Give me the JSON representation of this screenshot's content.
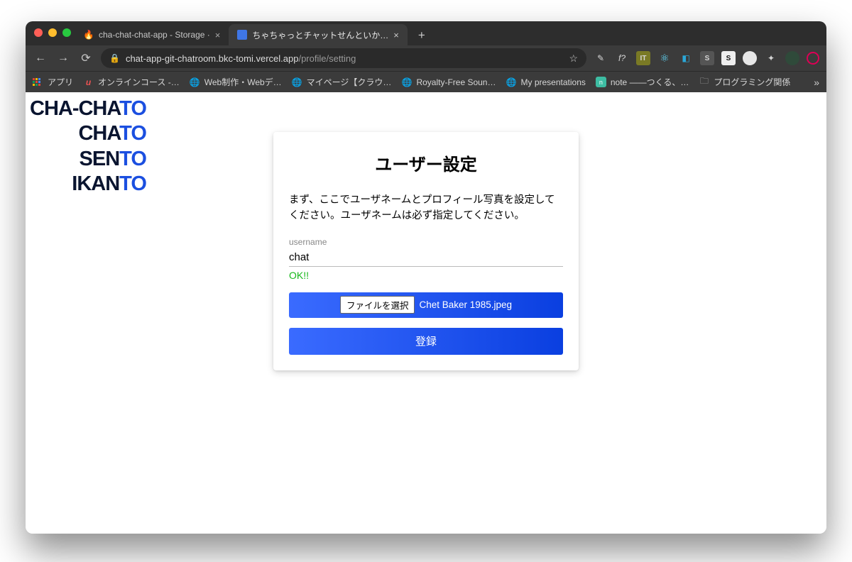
{
  "browser": {
    "tabs": [
      {
        "title": "cha-chat-chat-app - Storage ·",
        "active": false
      },
      {
        "title": "ちゃちゃっとチャットせんといか…",
        "active": true
      }
    ],
    "url_host": "chat-app-git-chatroom.bkc-tomi.vercel.app",
    "url_path": "/profile/setting",
    "bookmarks": {
      "apps": "アプリ",
      "items": [
        "オンラインコース -…",
        "Web制作・Webデ…",
        "マイページ【クラウ…",
        "Royalty-Free Soun…",
        "My presentations",
        "note ――つくる、…",
        "プログラミング関係"
      ]
    }
  },
  "logo": {
    "l1_pre": "CHA-CHA",
    "l1_suf": "TO",
    "l2_pre": "CHA",
    "l2_suf": "TO",
    "l3_pre": "SEN",
    "l3_suf": "TO",
    "l4_pre": "IKAN",
    "l4_suf": "TO"
  },
  "card": {
    "title": "ユーザー設定",
    "desc": "まず、ここでユーザネームとプロフィール写真を設定してください。ユーザネームは必ず指定してください。",
    "username_label": "username",
    "username_value": "chat",
    "status_ok": "OK!!",
    "file_button": "ファイルを選択",
    "file_name": "Chet Baker 1985.jpeg",
    "submit": "登録"
  }
}
